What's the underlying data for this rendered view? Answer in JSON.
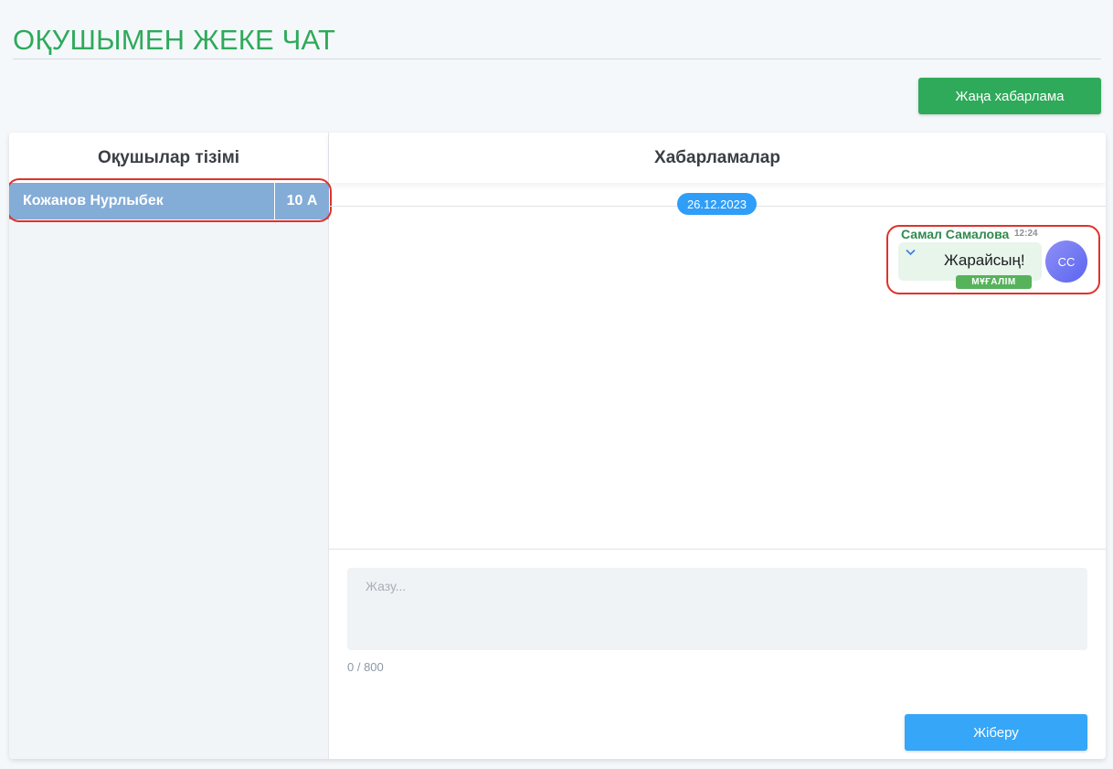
{
  "page": {
    "title": "ОҚУШЫМЕН ЖЕКЕ ЧАТ",
    "new_message_label": "Жаңа хабарлама"
  },
  "students_panel": {
    "header": "Оқушылар тізімі",
    "students": [
      {
        "name": "Кожанов Нурлыбек",
        "class": "10 А",
        "selected": true
      }
    ]
  },
  "messages_panel": {
    "header": "Хабарламалар",
    "date_separator": "26.12.2023",
    "messages": [
      {
        "author": "Самал Самалова",
        "time": "12:24",
        "text": "Жарайсың!",
        "role": "МҰҒАЛІМ",
        "avatar_initials": "СС"
      }
    ]
  },
  "composer": {
    "placeholder": "Жазу...",
    "value": "",
    "counter": "0 / 800",
    "send_label": "Жіберу"
  },
  "colors": {
    "title_green": "#2eaa5a",
    "selected_row": "#83acd6",
    "send_blue": "#36a6f8",
    "highlight_red": "#e0322b"
  },
  "icons": {
    "message_menu": "chevron-down-icon"
  }
}
